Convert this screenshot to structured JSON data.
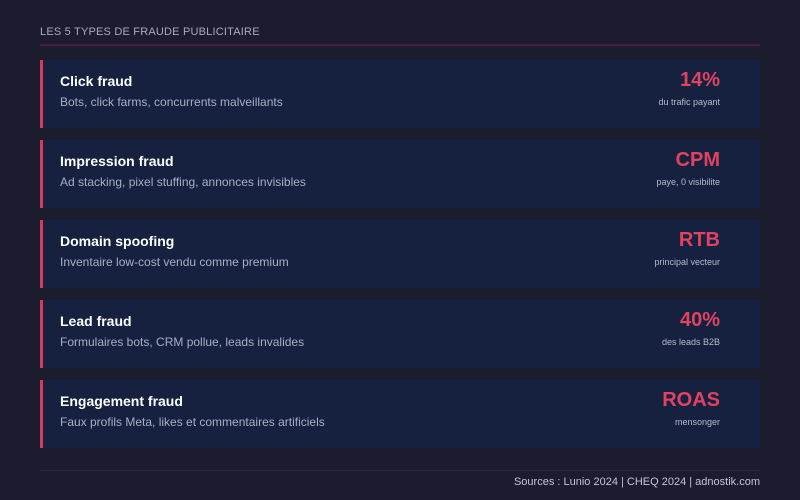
{
  "header": {
    "title": "LES 5 TYPES DE FRAUDE PUBLICITAIRE"
  },
  "colors": {
    "background": "#1b1c2e",
    "card": "#162140",
    "accent": "#d63a5e",
    "metric": "#e0425f"
  },
  "cards": [
    {
      "title": "Click fraud",
      "description": "Bots, click farms, concurrents malveillants",
      "metric": "14%",
      "metric_sub": "du trafic payant"
    },
    {
      "title": "Impression fraud",
      "description": "Ad stacking, pixel stuffing, annonces invisibles",
      "metric": "CPM",
      "metric_sub": "paye, 0 visibilite"
    },
    {
      "title": "Domain spoofing",
      "description": "Inventaire low-cost vendu comme premium",
      "metric": "RTB",
      "metric_sub": "principal vecteur"
    },
    {
      "title": "Lead fraud",
      "description": "Formulaires bots, CRM pollue, leads invalides",
      "metric": "40%",
      "metric_sub": "des leads B2B"
    },
    {
      "title": "Engagement fraud",
      "description": "Faux profils Meta, likes et commentaires artificiels",
      "metric": "ROAS",
      "metric_sub": "mensonger"
    }
  ],
  "footer": {
    "sources": "Sources : Lunio 2024 | CHEQ 2024 | adnostik.com"
  }
}
